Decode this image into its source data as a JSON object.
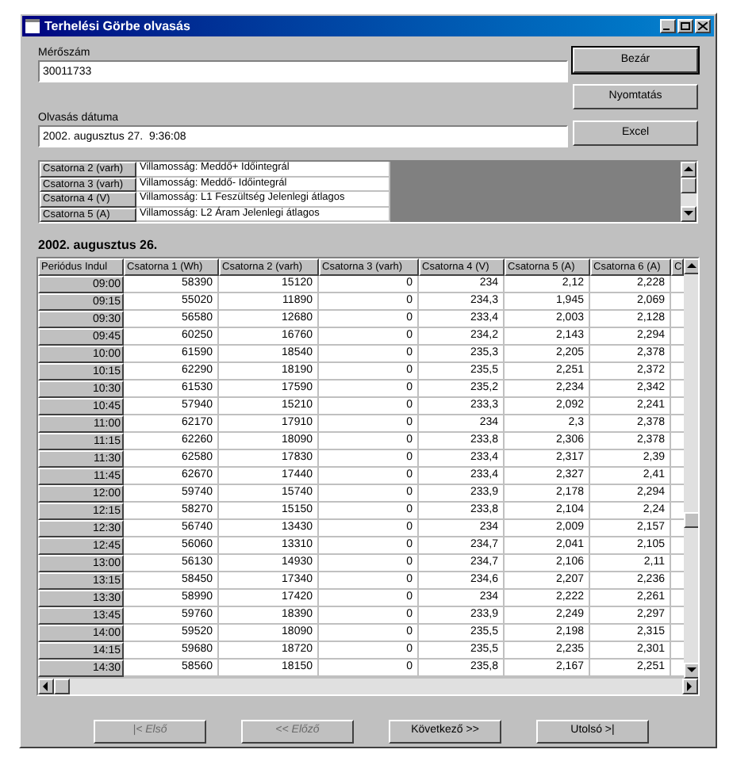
{
  "window": {
    "title": "Terhelési Görbe olvasás"
  },
  "meter": {
    "label": "Mérőszám",
    "value": "30011733"
  },
  "read_date": {
    "label": "Olvasás dátuma",
    "value": "2002. augusztus 27.  9:36:08"
  },
  "side_buttons": [
    "Bezár",
    "Nyomtatás",
    "Excel"
  ],
  "channels": [
    {
      "name": "Csatorna 2 (varh)",
      "description": "Villamosság: Meddő+ Időintegrál"
    },
    {
      "name": "Csatorna 3 (varh)",
      "description": "Villamosság: Meddő- Időintegrál"
    },
    {
      "name": "Csatorna 4 (V)",
      "description": "Villamosság: L1 Feszültség  Jelenlegi átlagos"
    },
    {
      "name": "Csatorna 5 (A)",
      "description": "Villamosság: L2 Áram  Jelenlegi átlagos"
    }
  ],
  "day_heading": "2002. augusztus 26.",
  "table": {
    "columns": [
      "Periódus Indul",
      "Csatorna 1 (Wh)",
      "Csatorna 2 (varh)",
      "Csatorna 3 (varh)",
      "Csatorna 4 (V)",
      "Csatorna 5 (A)",
      "Csatorna 6 (A)",
      "C"
    ],
    "rows": [
      [
        "09:00",
        "58390",
        "15120",
        "0",
        "234",
        "2,12",
        "2,228"
      ],
      [
        "09:15",
        "55020",
        "11890",
        "0",
        "234,3",
        "1,945",
        "2,069"
      ],
      [
        "09:30",
        "56580",
        "12680",
        "0",
        "233,4",
        "2,003",
        "2,128"
      ],
      [
        "09:45",
        "60250",
        "16760",
        "0",
        "234,2",
        "2,143",
        "2,294"
      ],
      [
        "10:00",
        "61590",
        "18540",
        "0",
        "235,3",
        "2,205",
        "2,378"
      ],
      [
        "10:15",
        "62290",
        "18190",
        "0",
        "235,5",
        "2,251",
        "2,372"
      ],
      [
        "10:30",
        "61530",
        "17590",
        "0",
        "235,2",
        "2,234",
        "2,342"
      ],
      [
        "10:45",
        "57940",
        "15210",
        "0",
        "233,3",
        "2,092",
        "2,241"
      ],
      [
        "11:00",
        "62170",
        "17910",
        "0",
        "234",
        "2,3",
        "2,378"
      ],
      [
        "11:15",
        "62260",
        "18090",
        "0",
        "233,8",
        "2,306",
        "2,378"
      ],
      [
        "11:30",
        "62580",
        "17830",
        "0",
        "233,4",
        "2,317",
        "2,39"
      ],
      [
        "11:45",
        "62670",
        "17440",
        "0",
        "233,4",
        "2,327",
        "2,41"
      ],
      [
        "12:00",
        "59740",
        "15740",
        "0",
        "233,9",
        "2,178",
        "2,294"
      ],
      [
        "12:15",
        "58270",
        "15150",
        "0",
        "233,8",
        "2,104",
        "2,24"
      ],
      [
        "12:30",
        "56740",
        "13430",
        "0",
        "234",
        "2,009",
        "2,157"
      ],
      [
        "12:45",
        "56060",
        "13310",
        "0",
        "234,7",
        "2,041",
        "2,105"
      ],
      [
        "13:00",
        "56130",
        "14930",
        "0",
        "234,7",
        "2,106",
        "2,11"
      ],
      [
        "13:15",
        "58450",
        "17340",
        "0",
        "234,6",
        "2,207",
        "2,236"
      ],
      [
        "13:30",
        "58990",
        "17420",
        "0",
        "234",
        "2,222",
        "2,261"
      ],
      [
        "13:45",
        "59760",
        "18390",
        "0",
        "233,9",
        "2,249",
        "2,297"
      ],
      [
        "14:00",
        "59520",
        "18090",
        "0",
        "235,5",
        "2,198",
        "2,315"
      ],
      [
        "14:15",
        "59680",
        "18720",
        "0",
        "235,5",
        "2,235",
        "2,301"
      ],
      [
        "14:30",
        "58560",
        "18150",
        "0",
        "235,8",
        "2,167",
        "2,251"
      ]
    ]
  },
  "nav_buttons": [
    {
      "label": "|< Első",
      "disabled": true
    },
    {
      "label": "<< Előző",
      "disabled": true
    },
    {
      "label": "Következő >>",
      "disabled": false
    },
    {
      "label": "Utolsó >|",
      "disabled": false
    }
  ]
}
